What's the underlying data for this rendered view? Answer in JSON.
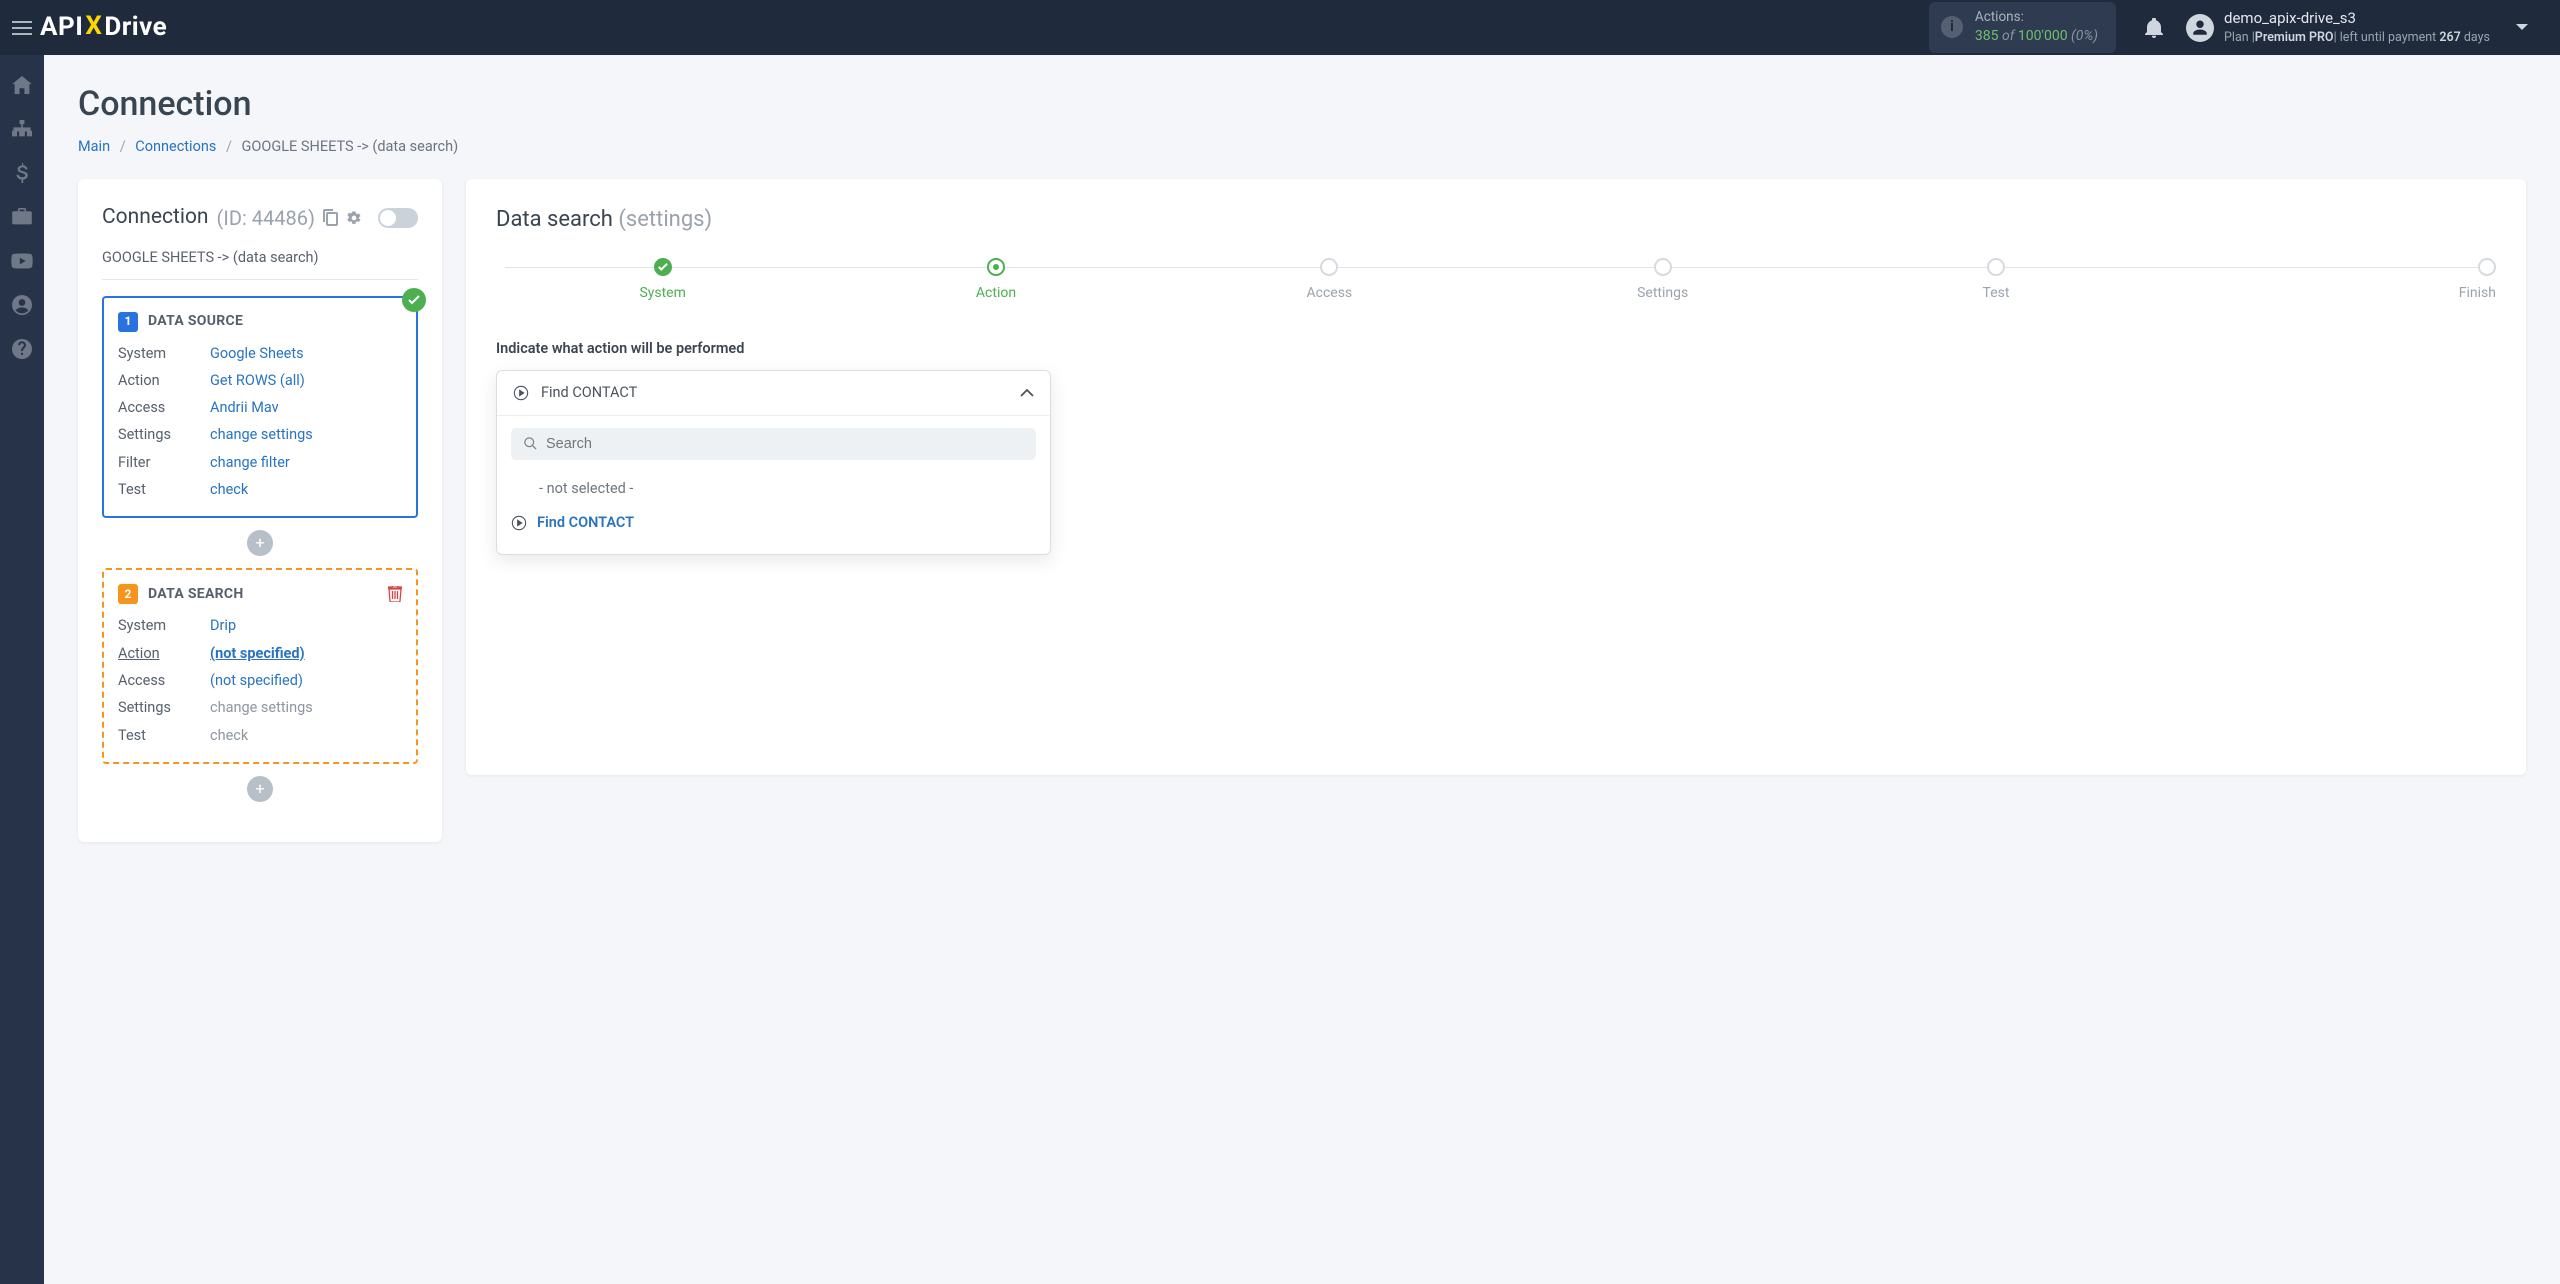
{
  "header": {
    "logo_api": "API",
    "logo_x": "X",
    "logo_drive": "Drive",
    "actions_label": "Actions:",
    "actions_used": "385",
    "actions_of": "of",
    "actions_limit": "100'000",
    "actions_pct": "(0%)",
    "user_name": "demo_apix-drive_s3",
    "plan_prefix": "Plan |",
    "plan_name": "Premium PRO",
    "plan_suffix1": "|  left until payment",
    "plan_days": "267",
    "plan_suffix2": "days"
  },
  "page": {
    "title": "Connection",
    "crumb_main": "Main",
    "crumb_connections": "Connections",
    "crumb_current": "GOOGLE SHEETS -> (data search)"
  },
  "left": {
    "title": "Connection",
    "id_label": "(ID: 44486)",
    "subtitle": "GOOGLE SHEETS -> (data search)",
    "plus": "+",
    "source": {
      "num": "1",
      "title": "DATA SOURCE",
      "rows": {
        "system_k": "System",
        "system_v": "Google Sheets",
        "action_k": "Action",
        "action_v": "Get ROWS (all)",
        "access_k": "Access",
        "access_v": "Andrii Mav",
        "settings_k": "Settings",
        "settings_v": "change settings",
        "filter_k": "Filter",
        "filter_v": "change filter",
        "test_k": "Test",
        "test_v": "check"
      }
    },
    "search": {
      "num": "2",
      "title": "DATA SEARCH",
      "rows": {
        "system_k": "System",
        "system_v": "Drip",
        "action_k": "Action",
        "action_v": "(not specified)",
        "access_k": "Access",
        "access_v": "(not specified)",
        "settings_k": "Settings",
        "settings_v": "change settings",
        "test_k": "Test",
        "test_v": "check"
      }
    }
  },
  "right": {
    "title": "Data search",
    "subtitle": "(settings)",
    "steps": [
      "System",
      "Action",
      "Access",
      "Settings",
      "Test",
      "Finish"
    ],
    "prompt": "Indicate what action will be performed",
    "selected": "Find CONTACT",
    "search_placeholder": "Search",
    "opt_none": "- not selected -",
    "opt_find": "Find CONTACT"
  }
}
